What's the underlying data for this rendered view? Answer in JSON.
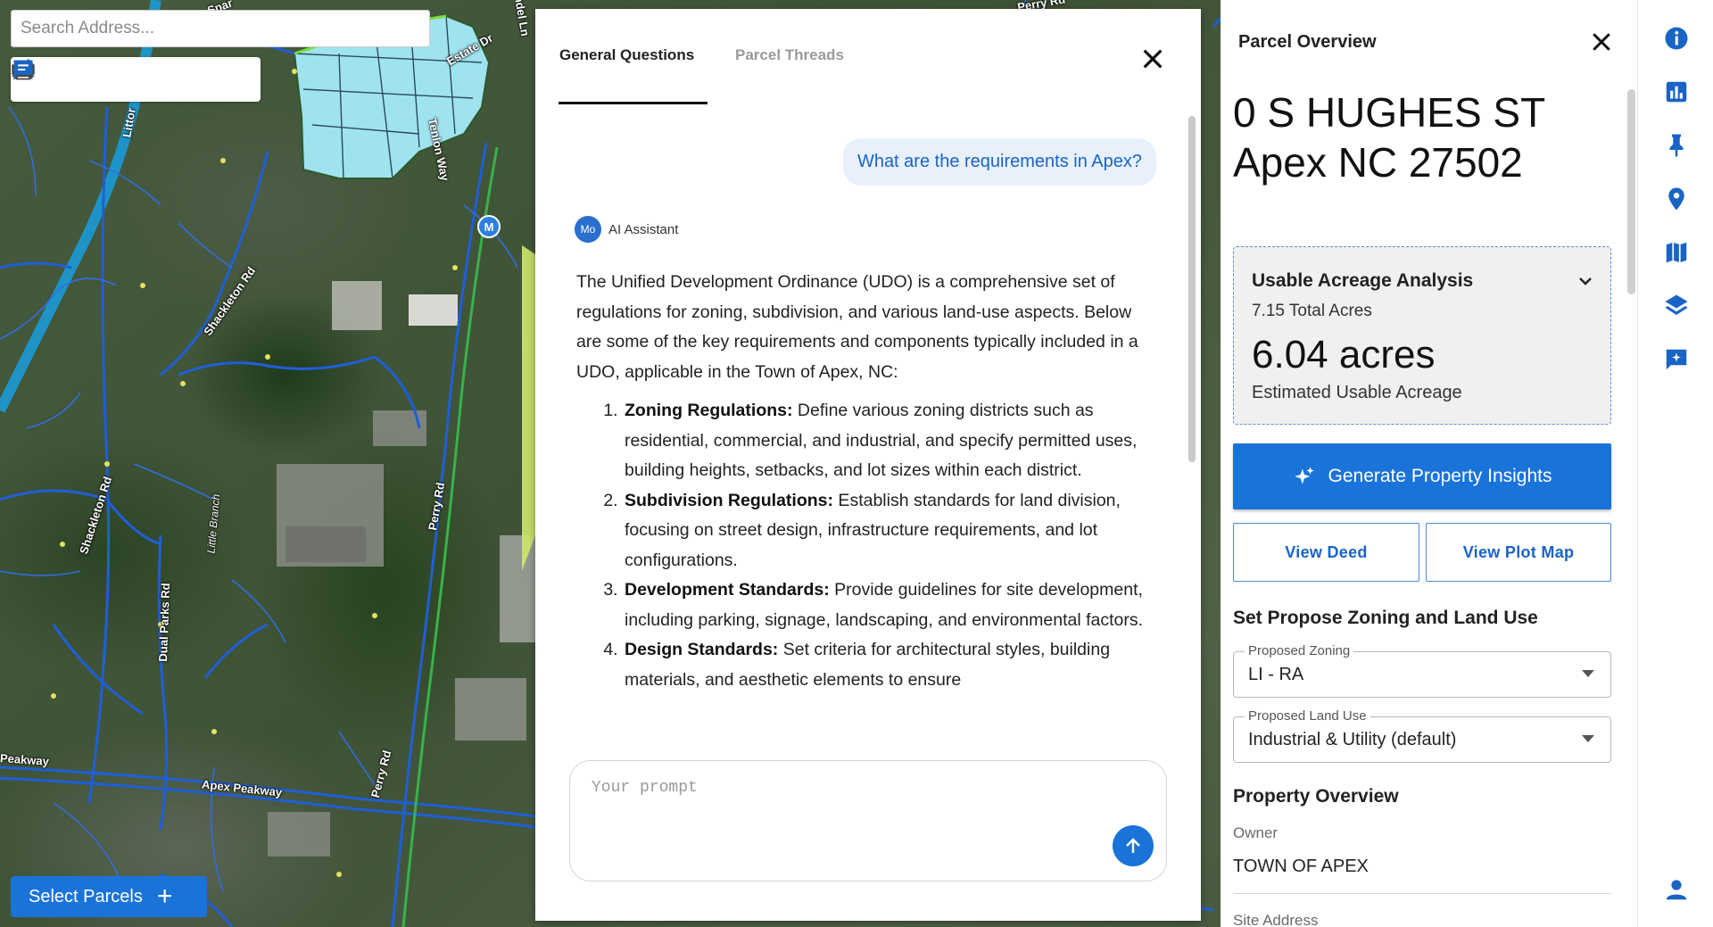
{
  "map": {
    "search_placeholder": "Search Address...",
    "road_labels": [
      "Estate Dr",
      "Perry Rd",
      "Littor",
      "Tenlon Way",
      "Shackleton Rd",
      "Shackleton Rd",
      "Little Branch",
      "Perry Rd",
      "Dual Parks Rd",
      "Perry Rd",
      "Apex Peakway",
      "Peakway",
      "ndel Ln",
      "Spar"
    ],
    "tools": [
      "ruler-icon",
      "angle-measure-icon",
      "draw-icon",
      "print-icon",
      "terrain-icon",
      "chat-icon"
    ],
    "marker_label": "M",
    "select_parcels_label": "Select Parcels",
    "colors": {
      "parcel_fill": "#9fe3f0",
      "road": "#1f5fd6",
      "highlight": "#d8f06a",
      "primary": "#1a73d9"
    }
  },
  "chat": {
    "tabs": [
      {
        "label": "General Questions",
        "active": true
      },
      {
        "label": "Parcel Threads",
        "active": false
      }
    ],
    "user_message": "What are the requirements in Apex?",
    "assistant": {
      "avatar_initials": "Mo",
      "name": "AI Assistant",
      "intro": "The Unified Development Ordinance (UDO) is a comprehensive set of regulations for zoning, subdivision, and various land-use aspects. Below are some of the key requirements and components typically included in a UDO, applicable in the Town of Apex, NC:",
      "items": [
        {
          "title": "Zoning Regulations:",
          "text": " Define various zoning districts such as residential, commercial, and industrial, and specify permitted uses, building heights, setbacks, and lot sizes within each district."
        },
        {
          "title": "Subdivision Regulations:",
          "text": " Establish standards for land division, focusing on street design, infrastructure requirements, and lot configurations."
        },
        {
          "title": "Development Standards:",
          "text": " Provide guidelines for site development, including parking, signage, landscaping, and environmental factors."
        },
        {
          "title": "Design Standards:",
          "text": " Set criteria for architectural styles, building materials, and aesthetic elements to ensure"
        }
      ]
    },
    "prompt_placeholder": "Your prompt"
  },
  "panel": {
    "title": "Parcel Overview",
    "address_line1": "0 S HUGHES ST",
    "address_line2": "Apex NC 27502",
    "acreage": {
      "title": "Usable Acreage Analysis",
      "total": "7.15 Total Acres",
      "value": "6.04 acres",
      "subtitle": "Estimated Usable Acreage"
    },
    "insights_button": "Generate Property Insights",
    "view_deed": "View Deed",
    "view_plot_map": "View Plot Map",
    "zoning_section": "Set Propose Zoning and Land Use",
    "proposed_zoning": {
      "label": "Proposed Zoning",
      "value": "LI - RA"
    },
    "proposed_land_use": {
      "label": "Proposed Land Use",
      "value": "Industrial & Utility (default)"
    },
    "property_section": "Property Overview",
    "owner_label": "Owner",
    "owner_value": "TOWN OF APEX",
    "site_address_label": "Site Address"
  },
  "rail": [
    "info-icon",
    "bar-chart-icon",
    "pin-icon",
    "location-icon",
    "map-icon",
    "layers-icon",
    "chat-add-icon",
    "user-icon"
  ]
}
